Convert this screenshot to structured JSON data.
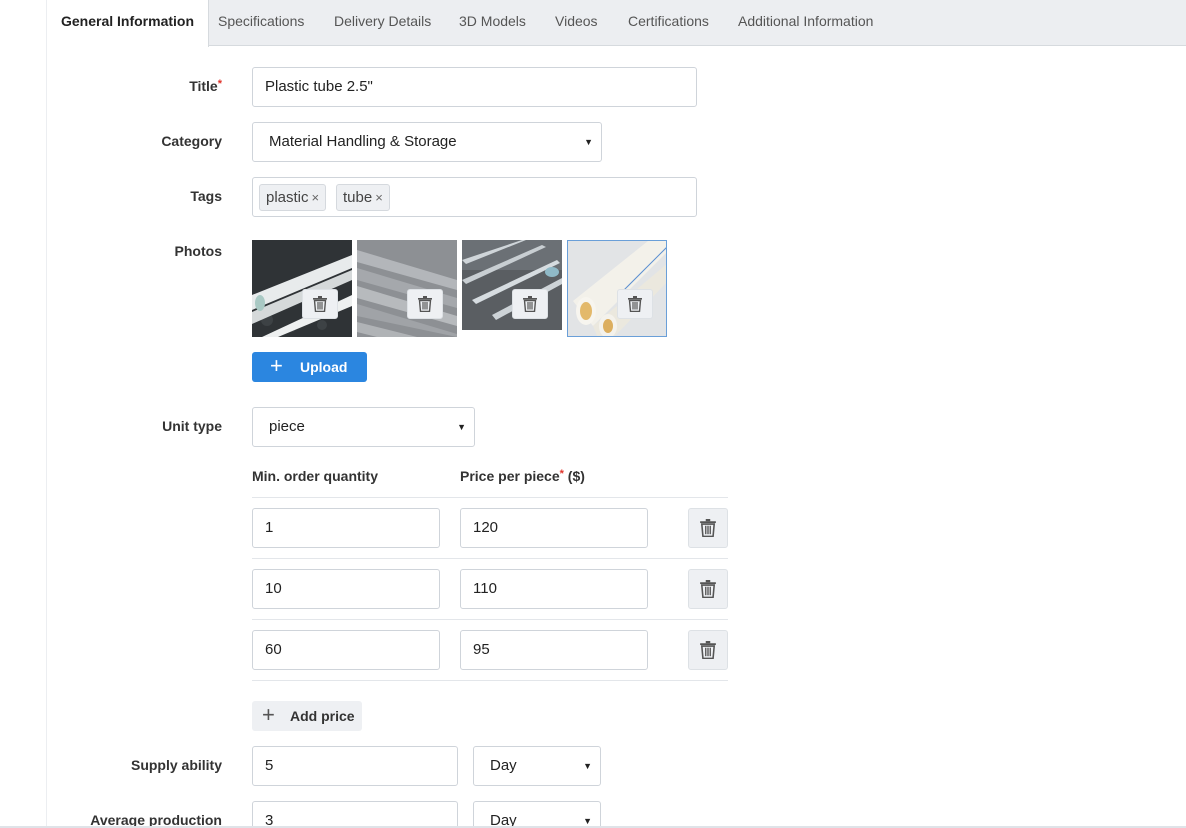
{
  "tabs": [
    {
      "label": "General Information",
      "active": true
    },
    {
      "label": "Specifications"
    },
    {
      "label": "Delivery Details"
    },
    {
      "label": "3D Models"
    },
    {
      "label": "Videos"
    },
    {
      "label": "Certifications"
    },
    {
      "label": "Additional Information"
    }
  ],
  "form": {
    "title_label": "Title",
    "required_mark": "*",
    "title_value": "Plastic tube 2.5\"",
    "category_label": "Category",
    "category_value": "Material Handling & Storage",
    "tags_label": "Tags",
    "tags": [
      "plastic",
      "tube"
    ],
    "tag_remove": "×",
    "photos_label": "Photos",
    "upload_label": "Upload",
    "unit_type_label": "Unit type",
    "unit_type_value": "piece",
    "min_order_header": "Min. order quantity",
    "price_header": "Price per piece",
    "price_unit": "($)",
    "price_rows": [
      {
        "qty": "1",
        "price": "120"
      },
      {
        "qty": "10",
        "price": "110"
      },
      {
        "qty": "60",
        "price": "95"
      }
    ],
    "add_price_label": "Add price",
    "supply_label": "Supply ability",
    "supply_value": "5",
    "supply_period": "Day",
    "avg_prod_label": "Average production",
    "avg_prod_value": "3",
    "avg_prod_period": "Day"
  },
  "icons": {
    "trash": "trash-icon",
    "plus": "plus-icon",
    "dropdown": "caret-down-icon"
  },
  "colors": {
    "accent": "#2b86e0",
    "required": "#e0342b",
    "tabbar": "#eceef1"
  }
}
